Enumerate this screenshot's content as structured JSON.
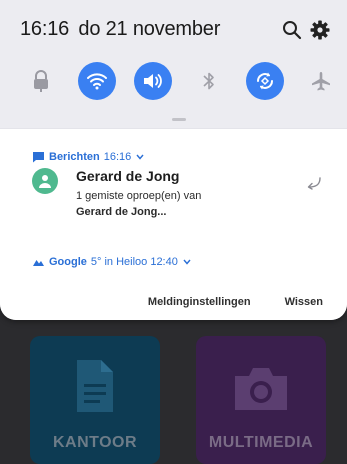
{
  "status": {
    "time": "16:16",
    "date": "do 21 november",
    "icons": [
      "search-icon",
      "gear-icon"
    ]
  },
  "quick_settings": [
    {
      "name": "lock-toggle",
      "icon": "lock-icon",
      "active": false
    },
    {
      "name": "wifi-toggle",
      "icon": "wifi-icon",
      "active": true
    },
    {
      "name": "sound-toggle",
      "icon": "sound-icon",
      "active": true
    },
    {
      "name": "bluetooth-toggle",
      "icon": "bluetooth-icon",
      "active": false
    },
    {
      "name": "autorotate-toggle",
      "icon": "autorotate-icon",
      "active": true
    },
    {
      "name": "airplane-toggle",
      "icon": "airplane-icon",
      "active": false
    }
  ],
  "notifications": [
    {
      "app": "Berichten",
      "time": "16:16",
      "sender": "Gerard de Jong",
      "line1": "1 gemiste oproep(en) van",
      "line2": "Gerard de Jong..."
    },
    {
      "app": "Google",
      "meta": "5° in Heiloo  12:40"
    }
  ],
  "actions": {
    "settings_label": "Meldinginstellingen",
    "clear_label": "Wissen"
  },
  "home_apps": [
    {
      "label": "KANTOOR"
    },
    {
      "label": "MULTIMEDIA"
    }
  ],
  "colors": {
    "accent": "#3a80f2",
    "link": "#2a6fd6",
    "avatar": "#4fb98f"
  }
}
